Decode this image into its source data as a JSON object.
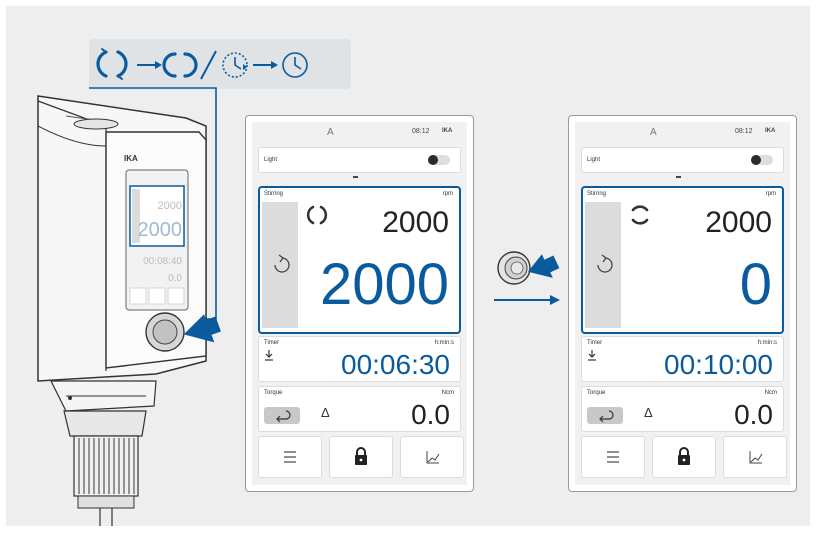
{
  "palette": {
    "accent": "#0a5b9e",
    "screen_bg": "#f1f1f1",
    "panel_bg": "#eeeeee",
    "symbol_bar_bg": "#dfe3e6"
  },
  "device": {
    "brand": "IKA",
    "mini_values": [
      "2000",
      "2000",
      "00:08:40",
      "0.0"
    ]
  },
  "symbol_bar": {
    "icons": [
      "stirring-active-icon",
      "arrow-right-icon",
      "stirring-icon",
      "slash-separator",
      "timer-active-icon",
      "arrow-right-icon",
      "timer-icon"
    ]
  },
  "screens": [
    {
      "status": {
        "letter": "A",
        "time": "08:12",
        "logo": "IKA"
      },
      "light": {
        "label": "Light",
        "state": "off"
      },
      "stirring": {
        "label": "Stirring",
        "unit": "rpm",
        "set_value": "2000",
        "actual_value": "2000",
        "icon": "stirring-active-icon"
      },
      "timer": {
        "label": "Timer",
        "unit": "h:min:s",
        "value": "00:06:30"
      },
      "torque": {
        "label": "Torque",
        "unit": "Ncm",
        "value": "0.0"
      },
      "buttons": [
        "menu-icon",
        "lock-icon",
        "graph-icon"
      ]
    },
    {
      "status": {
        "letter": "A",
        "time": "08:12",
        "logo": "IKA"
      },
      "light": {
        "label": "Light",
        "state": "off"
      },
      "stirring": {
        "label": "Stirring",
        "unit": "rpm",
        "set_value": "2000",
        "actual_value": "0",
        "icon": "stirring-ramp-icon"
      },
      "timer": {
        "label": "Timer",
        "unit": "h:min:s",
        "value": "00:10:00"
      },
      "torque": {
        "label": "Torque",
        "unit": "Ncm",
        "value": "0.0"
      },
      "buttons": [
        "menu-icon",
        "lock-icon",
        "graph-icon"
      ]
    }
  ],
  "transition": {
    "icon": "knob-press-icon",
    "arrow": "arrow-right-icon"
  }
}
